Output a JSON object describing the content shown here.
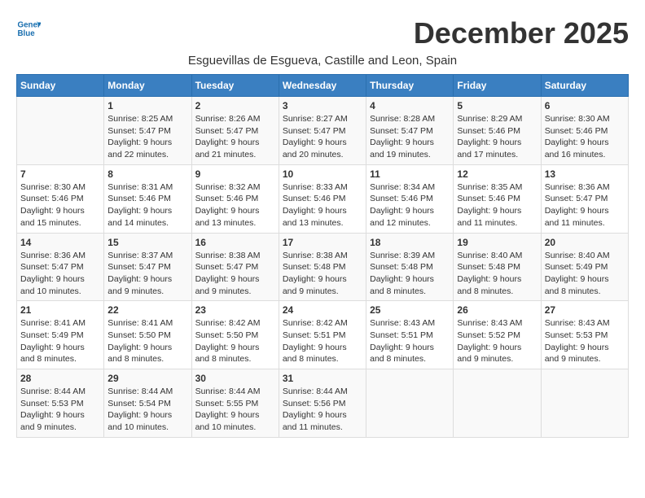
{
  "logo": {
    "line1": "General",
    "line2": "Blue"
  },
  "title": "December 2025",
  "subtitle": "Esguevillas de Esgueva, Castille and Leon, Spain",
  "weekdays": [
    "Sunday",
    "Monday",
    "Tuesday",
    "Wednesday",
    "Thursday",
    "Friday",
    "Saturday"
  ],
  "weeks": [
    [
      {
        "day": "",
        "content": ""
      },
      {
        "day": "1",
        "content": "Sunrise: 8:25 AM\nSunset: 5:47 PM\nDaylight: 9 hours\nand 22 minutes."
      },
      {
        "day": "2",
        "content": "Sunrise: 8:26 AM\nSunset: 5:47 PM\nDaylight: 9 hours\nand 21 minutes."
      },
      {
        "day": "3",
        "content": "Sunrise: 8:27 AM\nSunset: 5:47 PM\nDaylight: 9 hours\nand 20 minutes."
      },
      {
        "day": "4",
        "content": "Sunrise: 8:28 AM\nSunset: 5:47 PM\nDaylight: 9 hours\nand 19 minutes."
      },
      {
        "day": "5",
        "content": "Sunrise: 8:29 AM\nSunset: 5:46 PM\nDaylight: 9 hours\nand 17 minutes."
      },
      {
        "day": "6",
        "content": "Sunrise: 8:30 AM\nSunset: 5:46 PM\nDaylight: 9 hours\nand 16 minutes."
      }
    ],
    [
      {
        "day": "7",
        "content": "Sunrise: 8:30 AM\nSunset: 5:46 PM\nDaylight: 9 hours\nand 15 minutes."
      },
      {
        "day": "8",
        "content": "Sunrise: 8:31 AM\nSunset: 5:46 PM\nDaylight: 9 hours\nand 14 minutes."
      },
      {
        "day": "9",
        "content": "Sunrise: 8:32 AM\nSunset: 5:46 PM\nDaylight: 9 hours\nand 13 minutes."
      },
      {
        "day": "10",
        "content": "Sunrise: 8:33 AM\nSunset: 5:46 PM\nDaylight: 9 hours\nand 13 minutes."
      },
      {
        "day": "11",
        "content": "Sunrise: 8:34 AM\nSunset: 5:46 PM\nDaylight: 9 hours\nand 12 minutes."
      },
      {
        "day": "12",
        "content": "Sunrise: 8:35 AM\nSunset: 5:46 PM\nDaylight: 9 hours\nand 11 minutes."
      },
      {
        "day": "13",
        "content": "Sunrise: 8:36 AM\nSunset: 5:47 PM\nDaylight: 9 hours\nand 11 minutes."
      }
    ],
    [
      {
        "day": "14",
        "content": "Sunrise: 8:36 AM\nSunset: 5:47 PM\nDaylight: 9 hours\nand 10 minutes."
      },
      {
        "day": "15",
        "content": "Sunrise: 8:37 AM\nSunset: 5:47 PM\nDaylight: 9 hours\nand 9 minutes."
      },
      {
        "day": "16",
        "content": "Sunrise: 8:38 AM\nSunset: 5:47 PM\nDaylight: 9 hours\nand 9 minutes."
      },
      {
        "day": "17",
        "content": "Sunrise: 8:38 AM\nSunset: 5:48 PM\nDaylight: 9 hours\nand 9 minutes."
      },
      {
        "day": "18",
        "content": "Sunrise: 8:39 AM\nSunset: 5:48 PM\nDaylight: 9 hours\nand 8 minutes."
      },
      {
        "day": "19",
        "content": "Sunrise: 8:40 AM\nSunset: 5:48 PM\nDaylight: 9 hours\nand 8 minutes."
      },
      {
        "day": "20",
        "content": "Sunrise: 8:40 AM\nSunset: 5:49 PM\nDaylight: 9 hours\nand 8 minutes."
      }
    ],
    [
      {
        "day": "21",
        "content": "Sunrise: 8:41 AM\nSunset: 5:49 PM\nDaylight: 9 hours\nand 8 minutes."
      },
      {
        "day": "22",
        "content": "Sunrise: 8:41 AM\nSunset: 5:50 PM\nDaylight: 9 hours\nand 8 minutes."
      },
      {
        "day": "23",
        "content": "Sunrise: 8:42 AM\nSunset: 5:50 PM\nDaylight: 9 hours\nand 8 minutes."
      },
      {
        "day": "24",
        "content": "Sunrise: 8:42 AM\nSunset: 5:51 PM\nDaylight: 9 hours\nand 8 minutes."
      },
      {
        "day": "25",
        "content": "Sunrise: 8:43 AM\nSunset: 5:51 PM\nDaylight: 9 hours\nand 8 minutes."
      },
      {
        "day": "26",
        "content": "Sunrise: 8:43 AM\nSunset: 5:52 PM\nDaylight: 9 hours\nand 9 minutes."
      },
      {
        "day": "27",
        "content": "Sunrise: 8:43 AM\nSunset: 5:53 PM\nDaylight: 9 hours\nand 9 minutes."
      }
    ],
    [
      {
        "day": "28",
        "content": "Sunrise: 8:44 AM\nSunset: 5:53 PM\nDaylight: 9 hours\nand 9 minutes."
      },
      {
        "day": "29",
        "content": "Sunrise: 8:44 AM\nSunset: 5:54 PM\nDaylight: 9 hours\nand 10 minutes."
      },
      {
        "day": "30",
        "content": "Sunrise: 8:44 AM\nSunset: 5:55 PM\nDaylight: 9 hours\nand 10 minutes."
      },
      {
        "day": "31",
        "content": "Sunrise: 8:44 AM\nSunset: 5:56 PM\nDaylight: 9 hours\nand 11 minutes."
      },
      {
        "day": "",
        "content": ""
      },
      {
        "day": "",
        "content": ""
      },
      {
        "day": "",
        "content": ""
      }
    ]
  ]
}
